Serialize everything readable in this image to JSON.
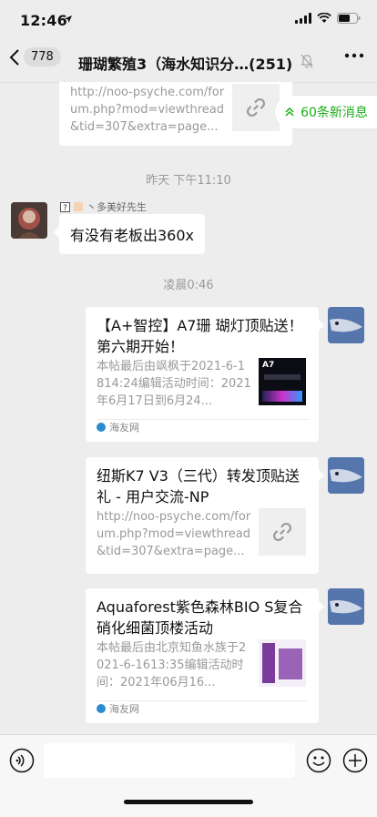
{
  "status": {
    "time": "12:46"
  },
  "nav": {
    "unread": "778",
    "title": "珊瑚繁殖3（海水知识分…(251)"
  },
  "new_messages": "60条新消息",
  "messages": {
    "top_link_desc": "http://noo-psyche.com/forum.php?mod=viewthread&tid=307&extra=page...",
    "ts1": "昨天 下午11:10",
    "sender_name": "丶多美好先生",
    "text1": "有没有老板出360x",
    "ts2": "凌晨0:46",
    "link1": {
      "title": "【A+智控】A7珊 瑚灯顶贴送！第六期开始！",
      "desc": "本帖最后由飒枫于2021-6-1814:24编辑活动时间：2021年6月17日到6月24...",
      "source": "海友网",
      "thumb_label": "A7"
    },
    "link2": {
      "title": "纽斯K7 V3（三代）转发顶贴送礼 - 用户交流-NP",
      "desc": "http://noo-psyche.com/forum.php?mod=viewthread&tid=307&extra=page..."
    },
    "link3": {
      "title": "Aquaforest紫色森林BIO S复合硝化细菌顶楼活动",
      "desc": "本帖最后由北京知鱼水族于2021-6-1613:35编辑活动时间：2021年06月16...",
      "source": "海友网"
    }
  },
  "colors": {
    "accent_green": "#1aad19",
    "bg": "#ededed"
  }
}
